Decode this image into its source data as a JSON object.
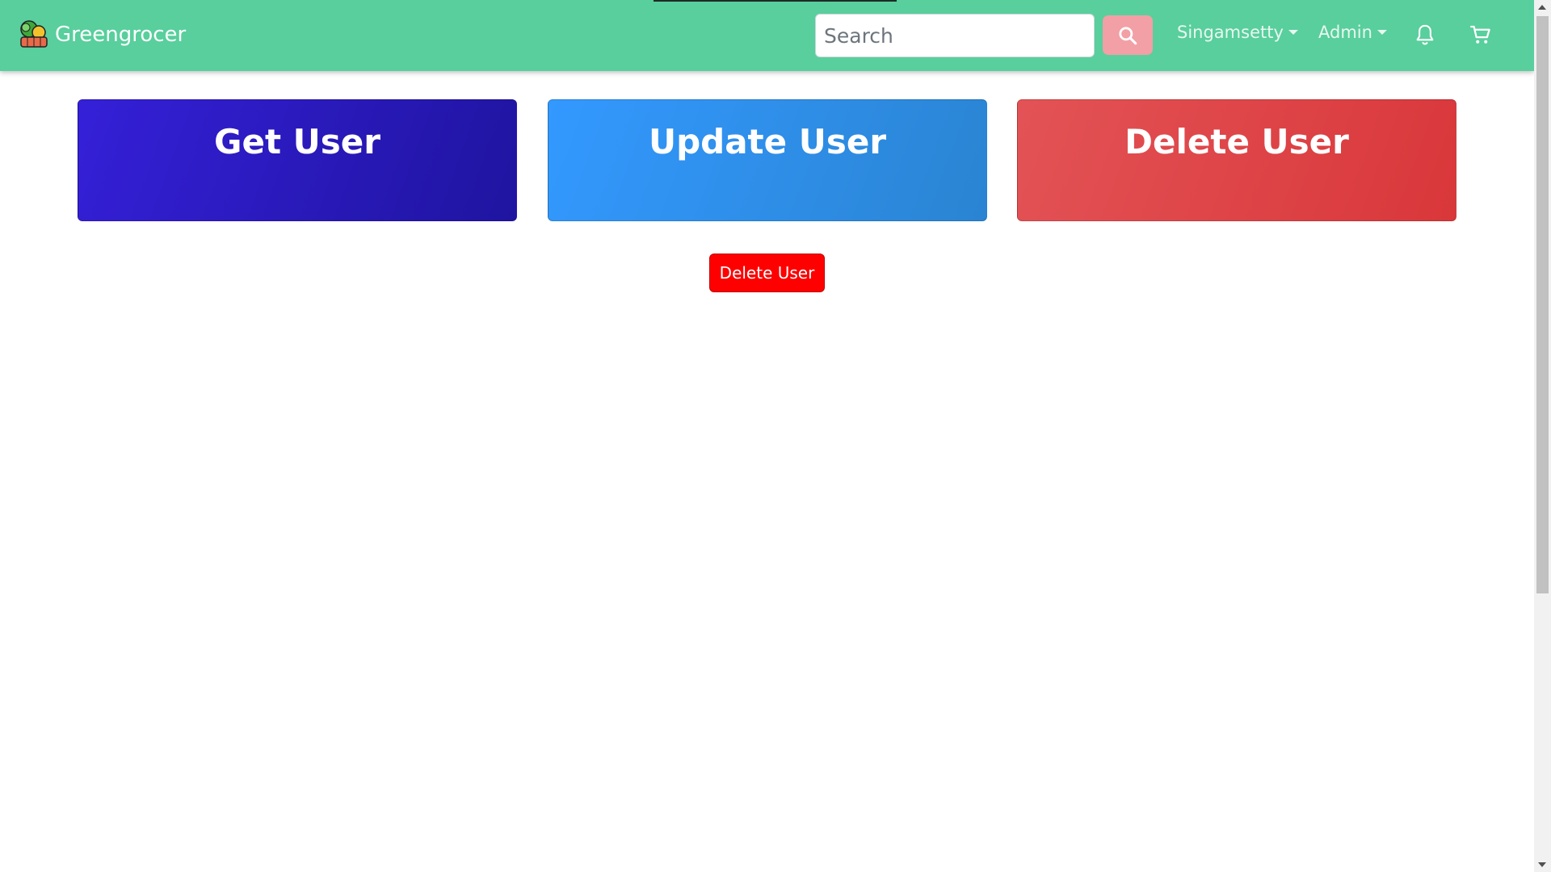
{
  "navbar": {
    "brand": "Greengrocer",
    "brand_icon": "vegetable-basket-icon",
    "search_placeholder": "Search",
    "search_icon": "search-icon",
    "user_menu": "Singamsetty",
    "admin_menu": "Admin",
    "notifications_icon": "bell-icon",
    "cart_icon": "cart-icon",
    "colors": {
      "navbar_bg": "#58cf9c",
      "search_button": "#f29fa6"
    }
  },
  "cards": [
    {
      "label": "Get User",
      "color": "#2a1ac0"
    },
    {
      "label": "Update User",
      "color": "#2f8fe8"
    },
    {
      "label": "Delete User",
      "color": "#df4547"
    }
  ],
  "main": {
    "delete_button": "Delete User",
    "delete_button_color": "#fe0000"
  }
}
